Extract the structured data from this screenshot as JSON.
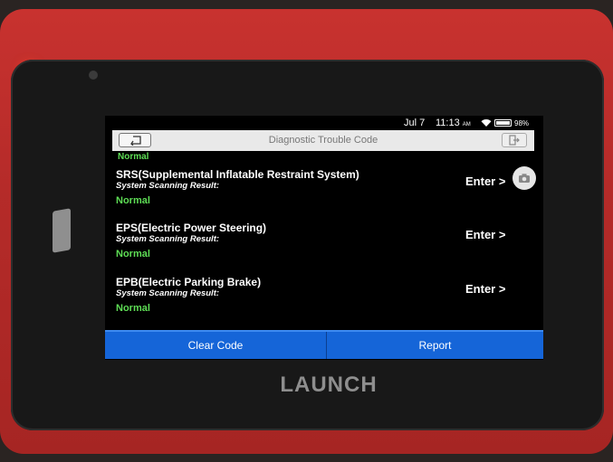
{
  "device": {
    "brand": "LAUNCH"
  },
  "status_bar": {
    "date": "Jul 7",
    "time": "11:13",
    "ampm": "AM",
    "battery": "98%"
  },
  "header": {
    "title": "Diagnostic Trouble Code"
  },
  "content": {
    "previous_status": "Normal",
    "systems": [
      {
        "name": "SRS(Supplemental Inflatable Restraint System)",
        "label": "System Scanning Result:",
        "result": "Normal",
        "action": "Enter >"
      },
      {
        "name": "EPS(Electric Power Steering)",
        "label": "System Scanning Result:",
        "result": "Normal",
        "action": "Enter >"
      },
      {
        "name": "EPB(Electric Parking Brake)",
        "label": "System Scanning Result:",
        "result": "Normal",
        "action": "Enter >"
      }
    ]
  },
  "actions": {
    "clear_code": "Clear Code",
    "report": "Report"
  },
  "colors": {
    "accent": "#1565d8",
    "normal": "#5edd55"
  },
  "icons": {
    "back": "back-arrow-icon",
    "exit": "exit-icon",
    "camera": "camera-icon",
    "wifi": "wifi-icon",
    "battery": "battery-icon"
  }
}
